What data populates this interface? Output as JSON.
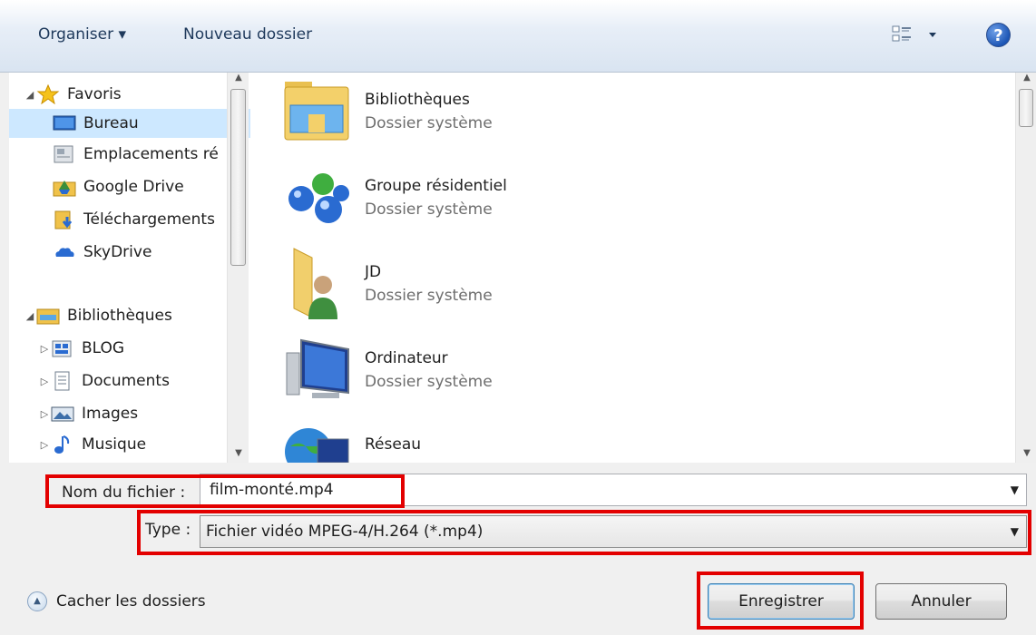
{
  "toolbar": {
    "organiser_label": "Organiser ▾",
    "nouveau_dossier_label": "Nouveau dossier",
    "help_label": "?"
  },
  "nav": {
    "favoris": {
      "label": "Favoris",
      "icon": "star-icon"
    },
    "favorites_items": [
      {
        "label": "Bureau",
        "icon": "desktop-icon",
        "selected": true
      },
      {
        "label": "Emplacements ré",
        "icon": "recent-places-icon"
      },
      {
        "label": "Google Drive",
        "icon": "google-drive-icon"
      },
      {
        "label": "Téléchargements",
        "icon": "downloads-icon"
      },
      {
        "label": "SkyDrive",
        "icon": "skydrive-icon"
      }
    ],
    "bibliotheques": {
      "label": "Bibliothèques",
      "icon": "libraries-icon"
    },
    "library_items": [
      {
        "label": "BLOG",
        "icon": "blog-library-icon"
      },
      {
        "label": "Documents",
        "icon": "documents-icon"
      },
      {
        "label": "Images",
        "icon": "images-icon"
      },
      {
        "label": "Musique",
        "icon": "music-icon"
      }
    ]
  },
  "content": {
    "items": [
      {
        "name": "Bibliothèques",
        "desc": "Dossier système",
        "icon": "libraries-folder-icon"
      },
      {
        "name": "Groupe résidentiel",
        "desc": "Dossier système",
        "icon": "homegroup-icon"
      },
      {
        "name": "JD",
        "desc": "Dossier système",
        "icon": "user-folder-icon"
      },
      {
        "name": "Ordinateur",
        "desc": "Dossier système",
        "icon": "computer-icon"
      },
      {
        "name": "Réseau",
        "desc": "",
        "icon": "network-icon"
      }
    ]
  },
  "form": {
    "filename_label": "Nom du fichier :",
    "filename_value": "film-monté.mp4",
    "type_label": "Type :",
    "type_value": "Fichier vidéo MPEG-4/H.264 (*.mp4)"
  },
  "footer": {
    "hide_folders_label": "Cacher les dossiers",
    "save_label": "Enregistrer",
    "cancel_label": "Annuler"
  },
  "colors": {
    "highlight": "#e30000",
    "selection": "#cde8ff"
  }
}
